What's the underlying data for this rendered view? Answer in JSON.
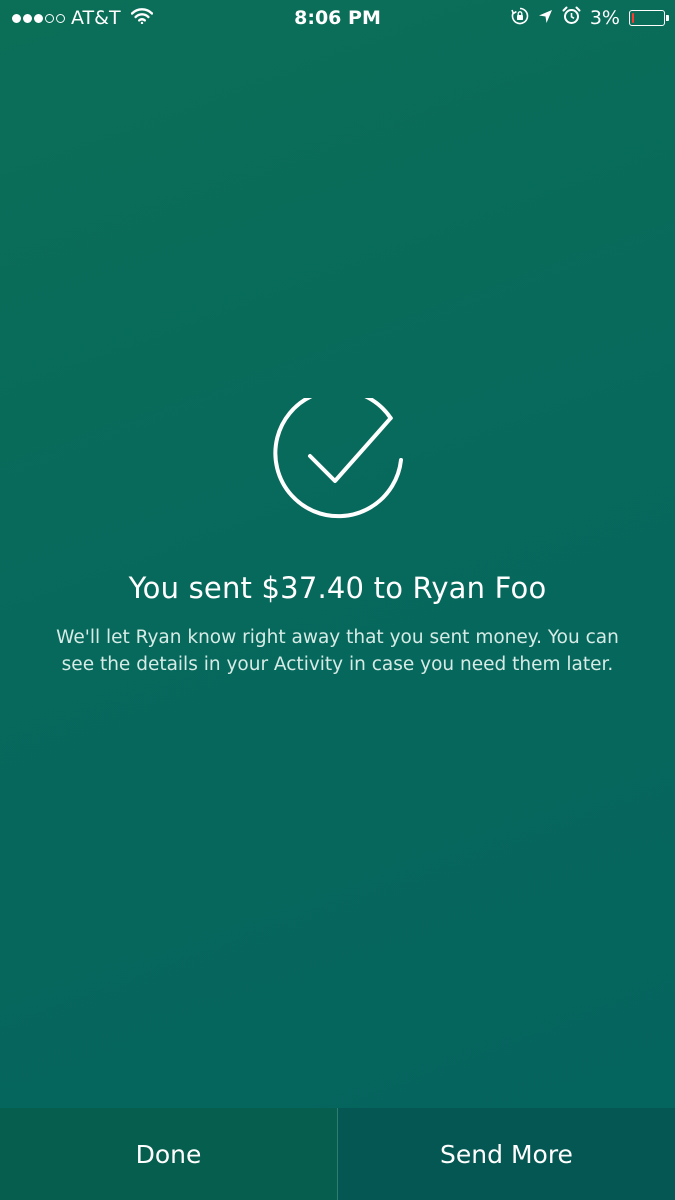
{
  "status_bar": {
    "signal_dots": 5,
    "signal_filled": 3,
    "carrier": "AT&T",
    "time": "8:06 PM",
    "battery_percent": "3%",
    "battery_level": 0.03,
    "icons": [
      "wifi-icon",
      "rotation-lock-icon",
      "location-arrow-icon",
      "alarm-icon",
      "battery-icon"
    ]
  },
  "confirmation": {
    "icon": "check-circle-icon",
    "title": "You sent $37.40 to Ryan Foo",
    "message": "We'll let Ryan know right away that you sent money. You can see the details in your Activity in case you need them later."
  },
  "actions": {
    "done_label": "Done",
    "send_more_label": "Send More"
  },
  "colors": {
    "background": "#07695c",
    "bottom_bar": "#055a4f",
    "text": "#ffffff",
    "battery_low": "#ff3b30"
  }
}
